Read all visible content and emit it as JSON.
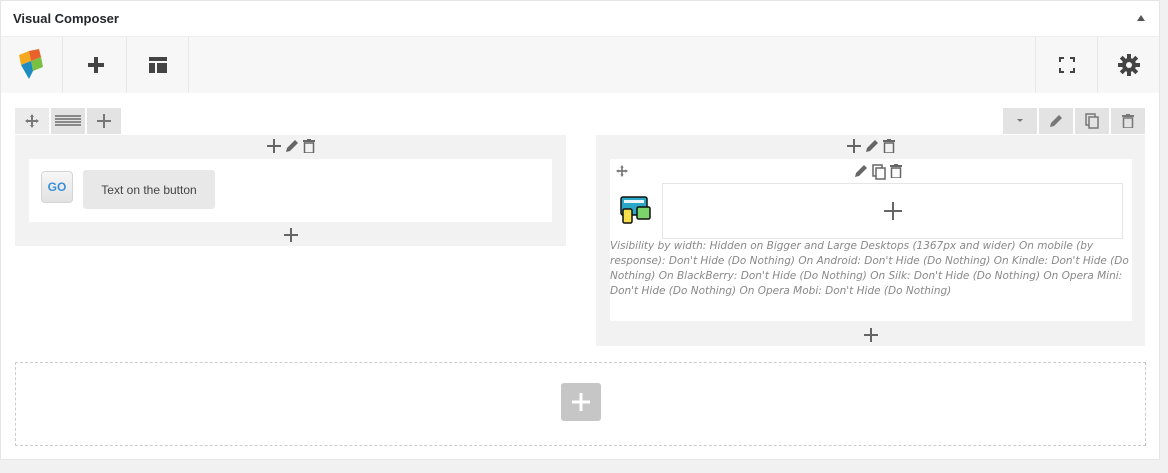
{
  "panel": {
    "title": "Visual Composer"
  },
  "toolbar": {
    "logo_icon": "vc-logo-icon",
    "add_icon": "plus-icon",
    "templates_icon": "templates-icon",
    "fullscreen_icon": "fullscreen-icon",
    "settings_icon": "gear-icon"
  },
  "row": {
    "left_controls": [
      "move-icon",
      "layout-icon",
      "plus-icon"
    ],
    "right_controls": [
      "chevron-down-icon",
      "pencil-icon",
      "clone-icon",
      "trash-icon"
    ]
  },
  "column_left": {
    "element_badge": "GO",
    "button_text": "Text on the button"
  },
  "column_right": {
    "visibility_text": "Visibility by width: Hidden on Bigger and Large Desktops (1367px and wider)  On mobile (by response): Don't Hide (Do Nothing)  On Android: Don't Hide (Do Nothing)  On Kindle: Don't Hide (Do Nothing)  On BlackBerry: Don't Hide (Do Nothing)  On Silk: Don't Hide (Do Nothing)  On Opera Mini: Don't Hide (Do Nothing)  On Opera Mobi: Don't Hide (Do Nothing)"
  },
  "colors": {
    "accent_blue": "#3b8fd6",
    "panel_bg": "#ffffff",
    "column_bg": "#f2f2f2"
  }
}
